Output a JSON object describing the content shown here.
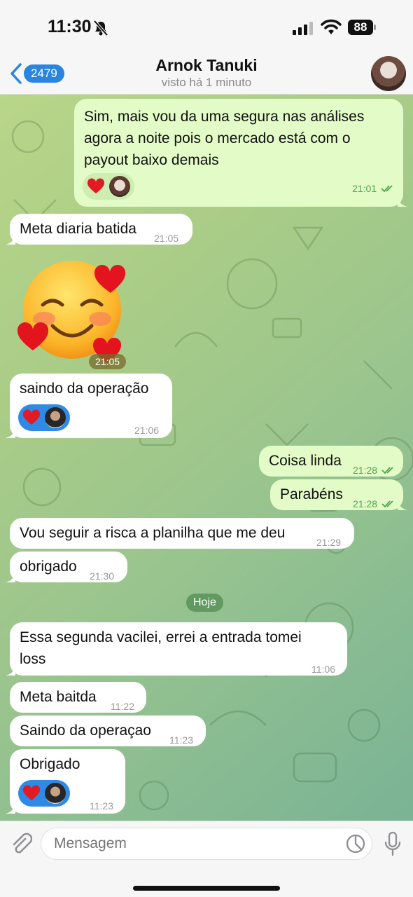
{
  "status_bar": {
    "time": "11:30",
    "battery": "88"
  },
  "header": {
    "back_count": "2479",
    "title": "Arnok Tanuki",
    "subtitle": "visto há 1 minuto"
  },
  "messages": [
    {
      "side": "out",
      "text_lines": [
        "Sim, mais vou da uma segura nas análises",
        "agora a noite pois o mercado está com o",
        "payout baixo demais"
      ],
      "time": "21:01",
      "reaction": "heart"
    },
    {
      "side": "in",
      "text": "Meta diaria batida",
      "time": "21:05"
    },
    {
      "side": "in",
      "type": "sticker",
      "sticker": "smiling-face-with-hearts",
      "time": "21:05"
    },
    {
      "side": "in",
      "text": "saindo da operação",
      "time": "21:06",
      "reaction": "heart"
    },
    {
      "side": "out",
      "text": "Coisa linda",
      "time": "21:28"
    },
    {
      "side": "out",
      "text": "Parabéns",
      "time": "21:28"
    },
    {
      "side": "in",
      "text": "Vou seguir a risca a planilha que me deu",
      "time": "21:29"
    },
    {
      "side": "in",
      "text": "obrigado",
      "time": "21:30"
    },
    {
      "side": "in",
      "text_lines": [
        "Essa segunda vacilei, errei a entrada  tomei",
        "loss"
      ],
      "time": "11:06"
    },
    {
      "side": "in",
      "text": "Meta baitda",
      "time": "11:22"
    },
    {
      "side": "in",
      "text": "Saindo da operaçao",
      "time": "11:23"
    },
    {
      "side": "in",
      "text": "Obrigado",
      "time": "11:23",
      "reaction": "heart"
    }
  ],
  "date_separator": "Hoje",
  "composer": {
    "placeholder": "Mensagem"
  },
  "colors": {
    "accent": "#2a85e0",
    "outgoing_bubble": "#e2fbc7",
    "incoming_bubble": "#ffffff",
    "read_check": "#4fa44f"
  }
}
